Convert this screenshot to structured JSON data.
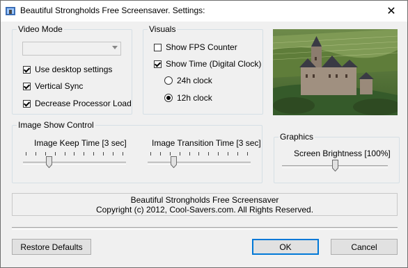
{
  "window": {
    "title": "Beautiful Strongholds Free Screensaver. Settings:",
    "close_glyph": "✕"
  },
  "video_mode": {
    "legend": "Video Mode",
    "combo_value": "",
    "use_desktop_settings": {
      "label": "Use desktop settings",
      "checked": true
    },
    "vertical_sync": {
      "label": "Vertical Sync",
      "checked": true
    },
    "decrease_processor_load": {
      "label": "Decrease Processor Load",
      "checked": true
    }
  },
  "visuals": {
    "legend": "Visuals",
    "show_fps": {
      "label": "Show FPS Counter",
      "checked": false
    },
    "show_time": {
      "label": "Show Time (Digital Clock)",
      "checked": true
    },
    "clock_24h": {
      "label": "24h clock",
      "selected": false
    },
    "clock_12h": {
      "label": "12h clock",
      "selected": true
    }
  },
  "image_show_control": {
    "legend": "Image Show Control",
    "keep_time": {
      "label": "Image Keep Time [3 sec]",
      "value_fraction": 0.24
    },
    "transition_time": {
      "label": "Image Transition Time [3 sec]",
      "value_fraction": 0.24
    }
  },
  "graphics": {
    "legend": "Graphics",
    "brightness": {
      "label": "Screen Brightness [100%]",
      "value_fraction": 0.5
    }
  },
  "info": {
    "line1": "Beautiful Strongholds Free Screensaver",
    "line2": "Copyright (c) 2012, Cool-Savers.com. All Rights Reserved."
  },
  "buttons": {
    "restore_defaults": "Restore Defaults",
    "ok": "OK",
    "cancel": "Cancel"
  },
  "preview_image": {
    "alt": "castle-preview"
  },
  "colors": {
    "accent": "#0078d7"
  }
}
